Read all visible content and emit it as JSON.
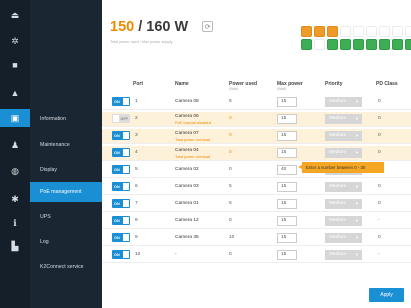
{
  "rail": {
    "icons": [
      {
        "name": "logout-icon",
        "glyph": "⏏"
      },
      {
        "name": "gear-icon",
        "glyph": "✲"
      },
      {
        "name": "camera-icon",
        "glyph": "■"
      },
      {
        "name": "alert-icon",
        "glyph": "▲"
      },
      {
        "name": "system-icon",
        "glyph": "▣"
      },
      {
        "name": "user-icon",
        "glyph": "♟"
      },
      {
        "name": "database-icon",
        "glyph": "◍"
      },
      {
        "name": "network-icon",
        "glyph": "✱"
      },
      {
        "name": "info-icon",
        "glyph": "ℹ"
      },
      {
        "name": "factory-icon",
        "glyph": "▙"
      }
    ]
  },
  "menu": {
    "items": [
      {
        "label": "Information"
      },
      {
        "label": "Maintenance"
      },
      {
        "label": "Display"
      },
      {
        "label": "PoE management"
      },
      {
        "label": "UPS"
      },
      {
        "label": "Log"
      },
      {
        "label": "K2Connect service"
      }
    ],
    "active_index": 3
  },
  "budget": {
    "used": "150",
    "total": " / 160 W",
    "subtitle": "Total power used / Max power supply"
  },
  "port_legend": {
    "on_label": "Power in use",
    "off_label": "Power off"
  },
  "port_panel": {
    "top_labels": [
      "1",
      "2",
      "3",
      "4",
      "5",
      "6",
      "7",
      "8",
      "9",
      "10"
    ],
    "top_states": [
      "over",
      "over",
      "over",
      "none",
      "none",
      "none",
      "none",
      "none",
      "none",
      "none"
    ],
    "bottom_labels": [
      "1",
      "2",
      "3",
      "4",
      "5",
      "6",
      "7",
      "8",
      "9",
      "10"
    ],
    "bottom_states": [
      "on",
      "none",
      "on",
      "on",
      "on",
      "on",
      "on",
      "on",
      "on",
      "none"
    ]
  },
  "table": {
    "headers": {
      "port": "Port",
      "name": "Name",
      "power_used": "Power used",
      "power_used_sub": "(Watt)",
      "max_power": "Max power",
      "max_power_sub": "(Watt)",
      "priority": "Priority",
      "pd_class": "PD Class"
    },
    "rows": [
      {
        "toggle": "ON",
        "port": "1",
        "name": "Camera 08",
        "error": "",
        "used": "5",
        "max": "15",
        "priority": "Medium",
        "pd": "0",
        "warn": false
      },
      {
        "toggle": "OFF",
        "port": "2",
        "name": "Camera 06",
        "error": "PoE manual disabled",
        "used": "0",
        "max": "15",
        "priority": "Medium",
        "pd": "0",
        "warn": true
      },
      {
        "toggle": "ON",
        "port": "3",
        "name": "Camera 07",
        "error": "Total power overload",
        "used": "0",
        "max": "15",
        "priority": "Medium",
        "pd": "0",
        "warn": true
      },
      {
        "toggle": "ON",
        "port": "4",
        "name": "Camera 04",
        "error": "Total power overload",
        "used": "0",
        "max": "15",
        "priority": "Medium",
        "pd": "0",
        "warn": true
      },
      {
        "toggle": "ON",
        "port": "5",
        "name": "Camera 02",
        "error": "",
        "used": "0",
        "max": "40",
        "priority": "Medium",
        "pd": "0",
        "warn": false
      },
      {
        "toggle": "ON",
        "port": "6",
        "name": "Camera 03",
        "error": "",
        "used": "5",
        "max": "15",
        "priority": "Medium",
        "pd": "0",
        "warn": false
      },
      {
        "toggle": "ON",
        "port": "7",
        "name": "Camera 01",
        "error": "",
        "used": "5",
        "max": "15",
        "priority": "Medium",
        "pd": "0",
        "warn": false
      },
      {
        "toggle": "ON",
        "port": "8",
        "name": "Camera 12",
        "error": "",
        "used": "0",
        "max": "15",
        "priority": "Medium",
        "pd": "-",
        "warn": false
      },
      {
        "toggle": "ON",
        "port": "9",
        "name": "Camera 35",
        "error": "",
        "used": "10",
        "max": "15",
        "priority": "Medium",
        "pd": "0",
        "warn": false
      },
      {
        "toggle": "ON",
        "port": "10",
        "name": "-",
        "error": "",
        "used": "0",
        "max": "15",
        "priority": "Medium",
        "pd": "-",
        "warn": false
      }
    ]
  },
  "tooltip": "Enter a number between 0 - 30",
  "apply_label": "Apply",
  "colors": {
    "accent": "#1b8fd4",
    "warning": "#f08a00",
    "power_on": "#3dae54"
  }
}
